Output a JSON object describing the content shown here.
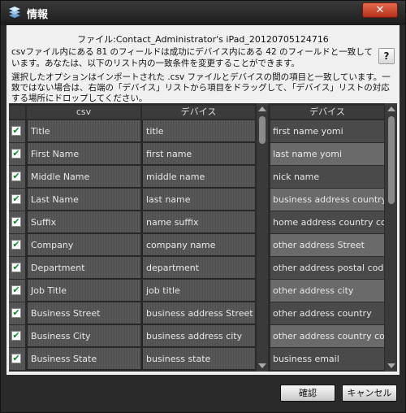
{
  "window": {
    "title": "情報",
    "close_label": "✕"
  },
  "file_label": "ファイル:Contact_Administrator's iPad_20120705124716",
  "description": "csvファイル内にある 81 のフィールドは成功にデバイス内にある 42 のフィールドと一致しています。あなたは、以下のリスト内の一致条件を変更することができます。",
  "help_label": "?",
  "instructions": "選択したオプションはインポートされた .csv ファイルとデバイスの間の項目と一致しています。一致ではない場合は、右端の「デバイス」リストから項目をドラッグして、「デバイス」リストの対応する場所にドロップしてください。",
  "table": {
    "headers": {
      "csv": "csv",
      "device": "デバイス"
    },
    "rows": [
      {
        "csv": "Title",
        "device": "title",
        "checked": true
      },
      {
        "csv": "First Name",
        "device": "first name",
        "checked": true
      },
      {
        "csv": "Middle Name",
        "device": "middle name",
        "checked": true
      },
      {
        "csv": "Last Name",
        "device": "last name",
        "checked": true
      },
      {
        "csv": "Suffix",
        "device": "name suffix",
        "checked": true
      },
      {
        "csv": "Company",
        "device": "company name",
        "checked": true
      },
      {
        "csv": "Department",
        "device": "department",
        "checked": true
      },
      {
        "csv": "Job Title",
        "device": "job title",
        "checked": true
      },
      {
        "csv": "Business Street",
        "device": "business address Street",
        "checked": true
      },
      {
        "csv": "Business City",
        "device": "business address city",
        "checked": true
      },
      {
        "csv": "Business State",
        "device": "business state",
        "checked": true
      }
    ]
  },
  "device_list": {
    "header": "デバイス",
    "items": [
      "first name yomi",
      "last name yomi",
      "nick name",
      "business address country code",
      "home address country code",
      "other address Street",
      "other address postal code",
      "other address city",
      "other address country",
      "other address country code",
      "business email"
    ]
  },
  "buttons": {
    "ok": "確認",
    "cancel": "キャンセル"
  },
  "colors": {
    "check": "#0a8a2a",
    "close": "#c4391f"
  }
}
